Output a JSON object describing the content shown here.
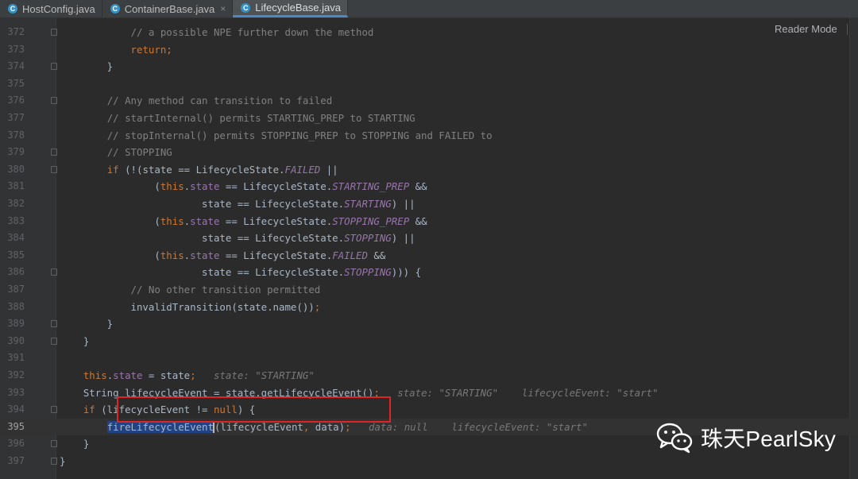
{
  "tabs": [
    {
      "label": "HostConfig.java",
      "icon": "java-class-icon",
      "active": false,
      "closable": false
    },
    {
      "label": "ContainerBase.java",
      "icon": "java-class-icon",
      "active": false,
      "closable": true
    },
    {
      "label": "LifecycleBase.java",
      "icon": "java-class-icon",
      "active": true,
      "closable": false
    }
  ],
  "tab_icon_letter": "C",
  "close_glyph": "×",
  "reader_mode_label": "Reader Mode",
  "lines": [
    {
      "num": "372",
      "tokens": [
        {
          "t": "            "
        },
        {
          "t": "// a possible NPE further down the method",
          "c": "cm"
        }
      ]
    },
    {
      "num": "373",
      "tokens": [
        {
          "t": "            "
        },
        {
          "t": "return",
          "c": "kw"
        },
        {
          "t": ";",
          "c": "kw"
        }
      ]
    },
    {
      "num": "374",
      "tokens": [
        {
          "t": "        }"
        }
      ]
    },
    {
      "num": "375",
      "tokens": []
    },
    {
      "num": "376",
      "tokens": [
        {
          "t": "        "
        },
        {
          "t": "// Any method can transition to failed",
          "c": "cm"
        }
      ]
    },
    {
      "num": "377",
      "tokens": [
        {
          "t": "        "
        },
        {
          "t": "// startInternal() permits STARTING_PREP to STARTING",
          "c": "cm"
        }
      ]
    },
    {
      "num": "378",
      "tokens": [
        {
          "t": "        "
        },
        {
          "t": "// stopInternal() permits STOPPING_PREP to STOPPING and FAILED to",
          "c": "cm"
        }
      ]
    },
    {
      "num": "379",
      "tokens": [
        {
          "t": "        "
        },
        {
          "t": "// STOPPING",
          "c": "cm"
        }
      ]
    },
    {
      "num": "380",
      "tokens": [
        {
          "t": "        "
        },
        {
          "t": "if",
          "c": "kw"
        },
        {
          "t": " (!(state == LifecycleState."
        },
        {
          "t": "FAILED",
          "c": "const"
        },
        {
          "t": " ||"
        }
      ]
    },
    {
      "num": "381",
      "tokens": [
        {
          "t": "                ("
        },
        {
          "t": "this",
          "c": "kw"
        },
        {
          "t": "."
        },
        {
          "t": "state",
          "c": "fld"
        },
        {
          "t": " == LifecycleState."
        },
        {
          "t": "STARTING_PREP",
          "c": "const"
        },
        {
          "t": " &&"
        }
      ]
    },
    {
      "num": "382",
      "tokens": [
        {
          "t": "                        state == LifecycleState."
        },
        {
          "t": "STARTING",
          "c": "const"
        },
        {
          "t": ") ||"
        }
      ]
    },
    {
      "num": "383",
      "tokens": [
        {
          "t": "                ("
        },
        {
          "t": "this",
          "c": "kw"
        },
        {
          "t": "."
        },
        {
          "t": "state",
          "c": "fld"
        },
        {
          "t": " == LifecycleState."
        },
        {
          "t": "STOPPING_PREP",
          "c": "const"
        },
        {
          "t": " &&"
        }
      ]
    },
    {
      "num": "384",
      "tokens": [
        {
          "t": "                        state == LifecycleState."
        },
        {
          "t": "STOPPING",
          "c": "const"
        },
        {
          "t": ") ||"
        }
      ]
    },
    {
      "num": "385",
      "tokens": [
        {
          "t": "                ("
        },
        {
          "t": "this",
          "c": "kw"
        },
        {
          "t": "."
        },
        {
          "t": "state",
          "c": "fld"
        },
        {
          "t": " == LifecycleState."
        },
        {
          "t": "FAILED",
          "c": "const"
        },
        {
          "t": " &&"
        }
      ]
    },
    {
      "num": "386",
      "tokens": [
        {
          "t": "                        state == LifecycleState."
        },
        {
          "t": "STOPPING",
          "c": "const"
        },
        {
          "t": "))) {"
        }
      ]
    },
    {
      "num": "387",
      "tokens": [
        {
          "t": "            "
        },
        {
          "t": "// No other transition permitted",
          "c": "cm"
        }
      ]
    },
    {
      "num": "388",
      "tokens": [
        {
          "t": "            invalidTransition(state.name())"
        },
        {
          "t": ";",
          "c": "kw"
        }
      ]
    },
    {
      "num": "389",
      "tokens": [
        {
          "t": "        }"
        }
      ]
    },
    {
      "num": "390",
      "tokens": [
        {
          "t": "    }"
        }
      ]
    },
    {
      "num": "391",
      "tokens": []
    },
    {
      "num": "392",
      "tokens": [
        {
          "t": "    "
        },
        {
          "t": "this",
          "c": "kw"
        },
        {
          "t": "."
        },
        {
          "t": "state",
          "c": "fld"
        },
        {
          "t": " = state"
        },
        {
          "t": ";",
          "c": "kw"
        },
        {
          "t": "   "
        },
        {
          "t": "state: \"STARTING\"",
          "c": "hint"
        }
      ]
    },
    {
      "num": "393",
      "tokens": [
        {
          "t": "    String lifecycleEvent = state.getLifecycleEvent()"
        },
        {
          "t": ";",
          "c": "kw"
        },
        {
          "t": "   "
        },
        {
          "t": "state: \"STARTING\"    lifecycleEvent: \"start\"",
          "c": "hint"
        }
      ]
    },
    {
      "num": "394",
      "tokens": [
        {
          "t": "    "
        },
        {
          "t": "if",
          "c": "kw"
        },
        {
          "t": " (lifecycleEvent != "
        },
        {
          "t": "null",
          "c": "kw"
        },
        {
          "t": ") {"
        }
      ]
    },
    {
      "num": "395",
      "current": true,
      "tokens": [
        {
          "t": "        "
        },
        {
          "t": "fireLifecycleEvent",
          "c": "sel"
        },
        {
          "t": "",
          "c": "caret"
        },
        {
          "t": "(lifecycleEvent"
        },
        {
          "t": ",",
          "c": "kw"
        },
        {
          "t": " data)"
        },
        {
          "t": ";",
          "c": "kw"
        },
        {
          "t": "   "
        },
        {
          "t": "data: null    lifecycleEvent: \"start\"",
          "c": "hint"
        }
      ]
    },
    {
      "num": "396",
      "tokens": [
        {
          "t": "    }"
        }
      ]
    },
    {
      "num": "397",
      "tokens": [
        {
          "t": "}"
        }
      ]
    }
  ],
  "watermark": {
    "text": "珠天PearlSky",
    "icon": "wechat-icon"
  }
}
